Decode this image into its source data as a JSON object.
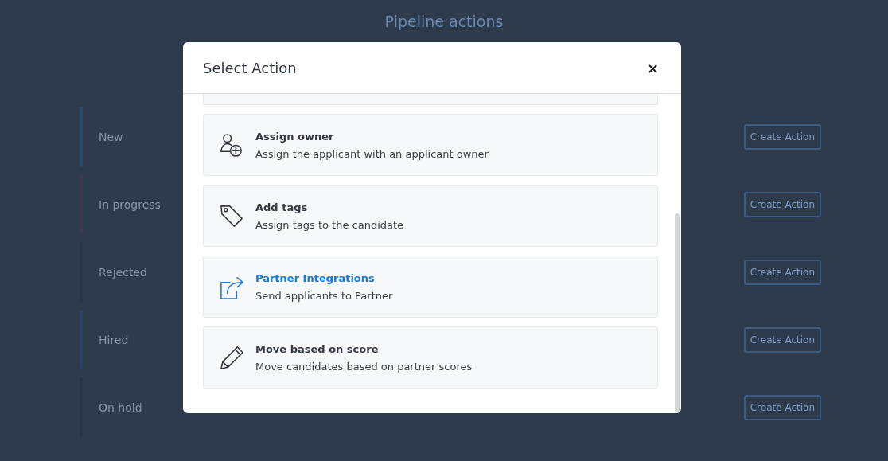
{
  "page": {
    "title": "Pipeline actions",
    "stages": [
      {
        "name": "New",
        "color": "#2b4a70",
        "button": "Create Action"
      },
      {
        "name": "In progress",
        "color": "#3a3a4a",
        "button": "Create Action"
      },
      {
        "name": "Rejected",
        "color": "#2a3444",
        "button": "Create Action"
      },
      {
        "name": "Hired",
        "color": "#2c4260",
        "button": "Create Action"
      },
      {
        "name": "On hold",
        "color": "#2a3444",
        "button": "Create Action"
      }
    ]
  },
  "dialog": {
    "title": "Select Action",
    "close": "×",
    "actions": [
      {
        "kind": "person-add",
        "title": "Assign owner",
        "description": "Assign the applicant with an applicant owner",
        "hovered": false
      },
      {
        "kind": "tag",
        "title": "Add tags",
        "description": "Assign tags to the candidate",
        "hovered": false
      },
      {
        "kind": "share",
        "title": "Partner Integrations",
        "description": "Send applicants to Partner",
        "hovered": true
      },
      {
        "kind": "pencil",
        "title": "Move based on score",
        "description": "Move candidates based on partner scores",
        "hovered": false
      }
    ]
  }
}
